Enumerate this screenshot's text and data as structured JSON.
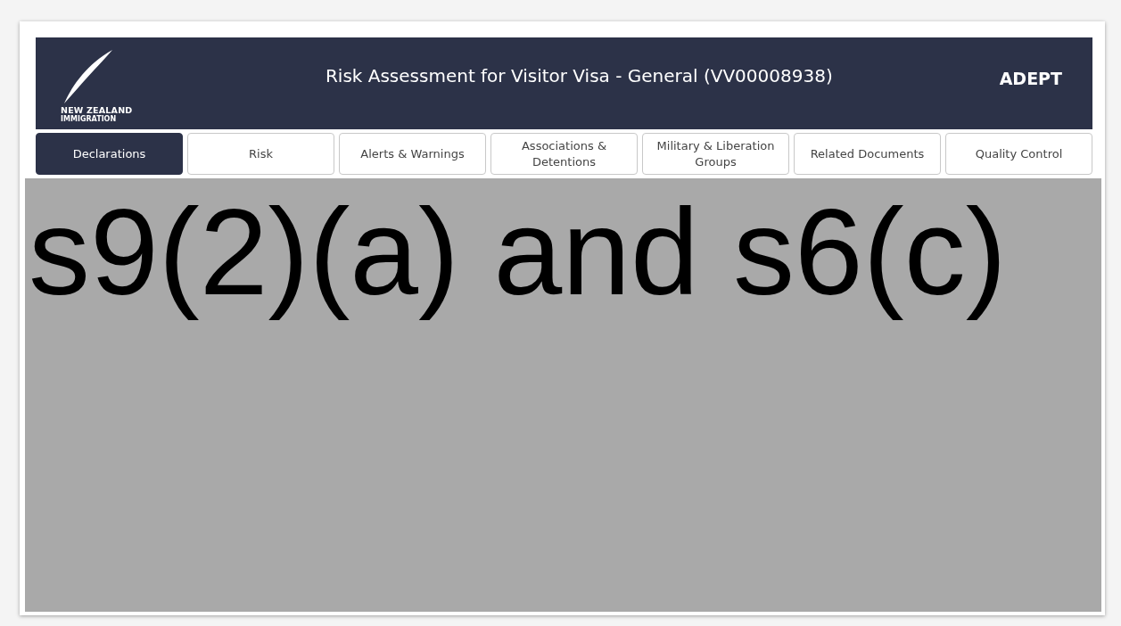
{
  "header": {
    "logo_line_1": "NEW ZEALAND",
    "logo_line_2": "IMMIGRATION",
    "title": "Risk Assessment for Visitor Visa - General (VV00008938)",
    "app_name": "ADEPT"
  },
  "tabs": [
    {
      "label": "Declarations",
      "selected": true
    },
    {
      "label": "Risk",
      "selected": false
    },
    {
      "label": "Alerts & Warnings",
      "selected": false
    },
    {
      "label": "Associations & Detentions",
      "selected": false
    },
    {
      "label": "Military & Liberation Groups",
      "selected": false
    },
    {
      "label": "Related Documents",
      "selected": false
    },
    {
      "label": "Quality Control",
      "selected": false
    }
  ],
  "redaction": {
    "label": "s9(2)(a) and s6(c)"
  }
}
